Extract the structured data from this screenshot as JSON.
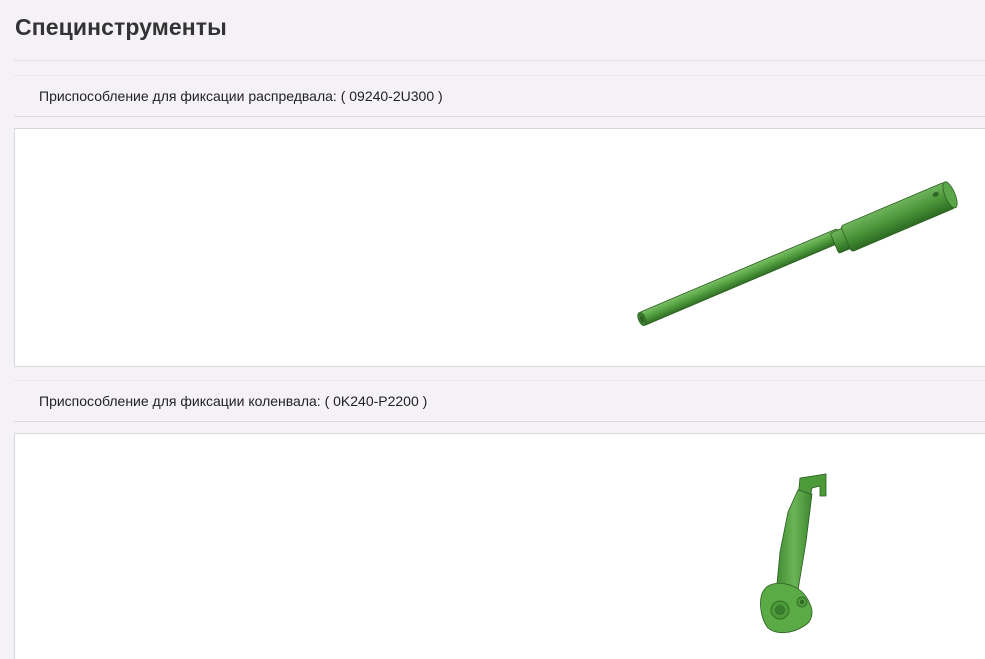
{
  "page": {
    "title": "Специнструменты"
  },
  "tools": [
    {
      "label": "Приспособление для фиксации распредвала: ( 09240-2U300 )",
      "image_icon": "camshaft-fixing-tool-icon"
    },
    {
      "label": "Приспособление для фиксации коленвала: ( 0K240-P2200 )",
      "image_icon": "crankshaft-fixing-tool-icon"
    }
  ],
  "colors": {
    "background": "#f4f2f6",
    "panel": "#ffffff",
    "tool_green": "#4f9a3c"
  }
}
